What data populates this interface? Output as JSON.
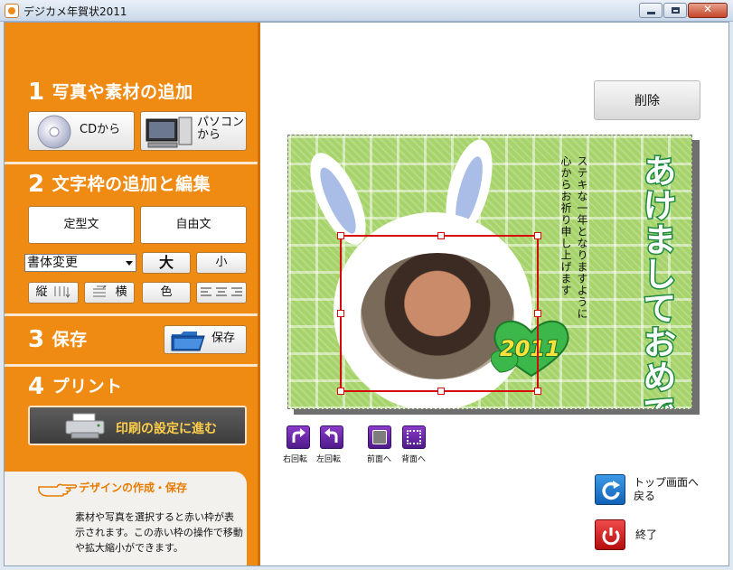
{
  "window": {
    "title": "デジカメ年賀状2011"
  },
  "sidebar": {
    "sections": [
      {
        "number": "1",
        "title": "写真や素材の追加"
      },
      {
        "number": "2",
        "title": "文字枠の追加と編集"
      },
      {
        "number": "3",
        "title": "保存"
      },
      {
        "number": "4",
        "title": "プリント"
      }
    ],
    "add_cd_label": "CDから",
    "add_pc_label_line1": "パソコン",
    "add_pc_label_line2": "から",
    "template_text_label": "定型文",
    "free_text_label": "自由文",
    "font_select_value": "書体変更",
    "size_large_label": "大",
    "size_small_label": "小",
    "vertical_label": "縦",
    "horizontal_label": "横",
    "color_label": "色",
    "save_label": "保存",
    "print_label": "印刷の設定に進む",
    "hint_title": "デザインの作成・保存",
    "hint_body": "素材や写真を選択すると赤い枠が表示されます。この赤い枠の操作で移動や拡大縮小ができます。"
  },
  "main": {
    "delete_label": "削除",
    "card": {
      "greeting_main": "あけましておめでとう！",
      "greeting_sub_line1": "ステキな一年となりますように",
      "greeting_sub_line2": "心からお祈り申し上げます",
      "year": "2011"
    },
    "tools": [
      {
        "label": "右回転"
      },
      {
        "label": "左回転"
      },
      {
        "label": "前面へ"
      },
      {
        "label": "背面へ"
      }
    ],
    "top_screen_label_line1": "トップ画面へ",
    "top_screen_label_line2": "戻る",
    "exit_label": "終了"
  }
}
